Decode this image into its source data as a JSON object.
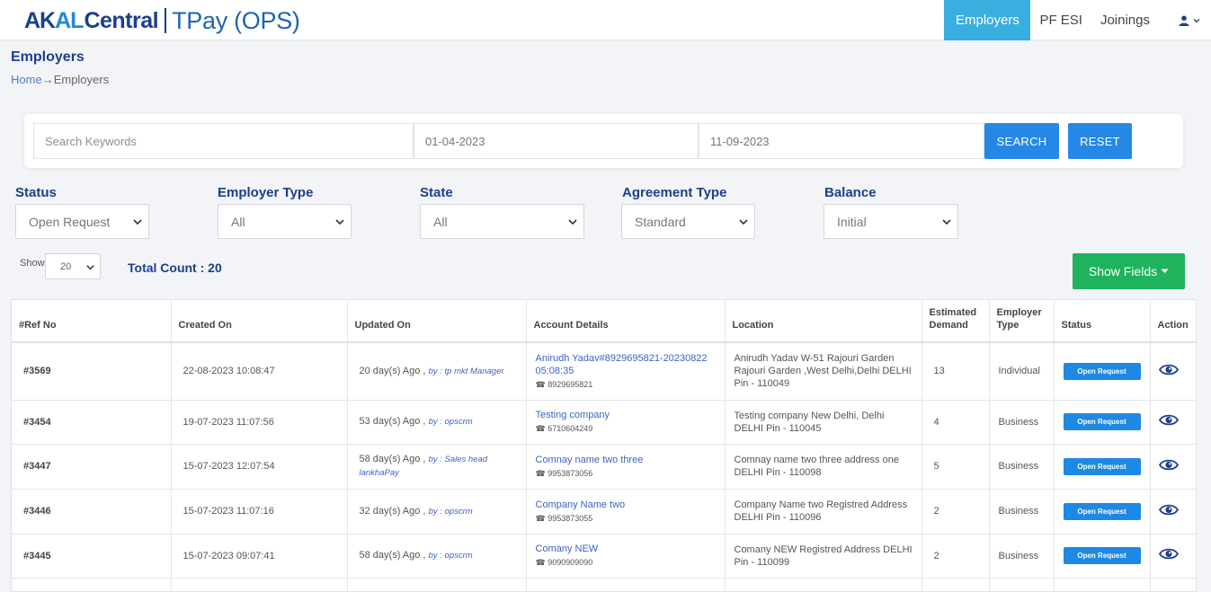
{
  "brand": {
    "akal_prefix": "AK",
    "akal_mid": "AL",
    "central": "Central",
    "product": "TPay (OPS)"
  },
  "nav": {
    "items": [
      "Employers",
      "PF ESI",
      "Joinings"
    ],
    "active": "Employers",
    "user_icon": "user-icon"
  },
  "page": {
    "title": "Employers",
    "breadcrumb_home": "Home",
    "breadcrumb_arrow": "→",
    "breadcrumb_current": "Employers"
  },
  "search": {
    "keywords_placeholder": "Search Keywords",
    "from_date": "01-04-2023",
    "to_date": "11-09-2023",
    "search_label": "SEARCH",
    "reset_label": "RESET"
  },
  "filters": [
    {
      "label": "Status",
      "value": "Open Request"
    },
    {
      "label": "Employer Type",
      "value": "All"
    },
    {
      "label": "State",
      "value": "All"
    },
    {
      "label": "Agreement Type",
      "value": "Standard"
    },
    {
      "label": "Balance",
      "value": "Initial"
    }
  ],
  "listing": {
    "show_label": "Show",
    "page_size": "20",
    "total_count": "Total Count : 20",
    "show_fields": "Show Fields"
  },
  "table": {
    "headers": [
      "#Ref No",
      "Created On",
      "Updated On",
      "Account Details",
      "Location",
      "Estimated Demand",
      "Employer Type",
      "Status",
      "Action"
    ],
    "rows": [
      {
        "ref": "#3569",
        "created": "22-08-2023 10:08:47",
        "updated_ago": "20 day(s) Ago ,",
        "updated_by": "by : tp mkt Manager",
        "account": "Anirudh Yadav#8929695821-20230822 05:08:35",
        "phone": "☎ 8929695821",
        "location": "Anirudh Yadav  W-51  Rajouri Garden Rajouri Garden  ,West Delhi,Delhi DELHI Pin - 110049",
        "demand": "13",
        "type": "Individual",
        "status": "Open Request"
      },
      {
        "ref": "#3454",
        "created": "19-07-2023 11:07:56",
        "updated_ago": "53 day(s) Ago ,",
        "updated_by": "by : opscrm",
        "account": "Testing company",
        "phone": "☎ 6710604249",
        "location": "Testing company  New Delhi, Delhi DELHI Pin - 110045",
        "demand": "4",
        "type": "Business",
        "status": "Open Request"
      },
      {
        "ref": "#3447",
        "created": "15-07-2023 12:07:54",
        "updated_ago": "58 day(s) Ago ,",
        "updated_by": "by : Sales head lankhaPay",
        "account": "Comnay name two three",
        "phone": "☎ 9953873056",
        "location": "Comnay name two three  address one  DELHI Pin - 110098",
        "demand": "5",
        "type": "Business",
        "status": "Open Request"
      },
      {
        "ref": "#3446",
        "created": "15-07-2023 11:07:16",
        "updated_ago": "32 day(s) Ago ,",
        "updated_by": "by : opscrm",
        "account": "Company Name two",
        "phone": "☎ 9953873055",
        "location": "Company Name two  Registred Address  DELHI Pin - 110096",
        "demand": "2",
        "type": "Business",
        "status": "Open Request"
      },
      {
        "ref": "#3445",
        "created": "15-07-2023 09:07:41",
        "updated_ago": "58 day(s) Ago ,",
        "updated_by": "by : opscrm",
        "account": "Comany NEW",
        "phone": "☎ 9090909090",
        "location": "Comany NEW  Registred Address DELHI Pin - 110099",
        "demand": "2",
        "type": "Business",
        "status": "Open Request"
      }
    ]
  },
  "colors": {
    "brand_navy": "#1c3f8c",
    "nav_active": "#3aaede",
    "primary_blue": "#2688e6",
    "success_green": "#1eb35c",
    "link_blue": "#3b63c4"
  }
}
